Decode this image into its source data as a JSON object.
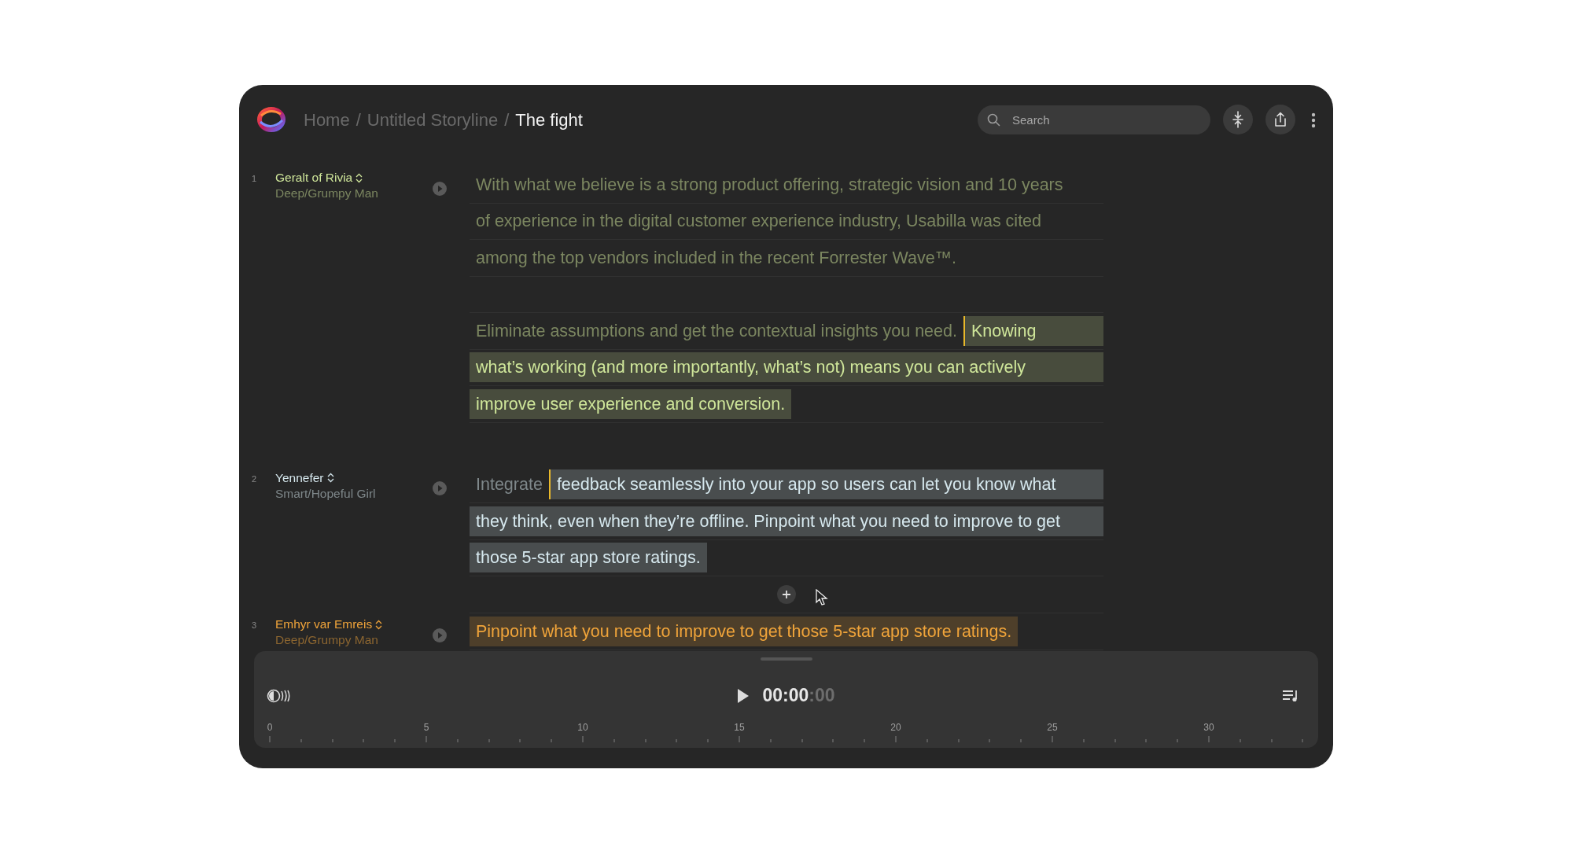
{
  "header": {
    "breadcrumbs": [
      {
        "label": "Home",
        "current": false
      },
      {
        "label": "Untitled Storyline",
        "current": false
      },
      {
        "label": "The fight",
        "current": true
      }
    ],
    "separators": [
      "/",
      "/"
    ],
    "search": {
      "placeholder": "Search"
    }
  },
  "script": [
    {
      "kind": "speaker",
      "number": "1",
      "name": "Geralt of Rivia",
      "voice": "Deep/Grumpy Man",
      "color": "#cfe69a",
      "paragraphs": [
        [
          [
            {
              "text": "With what we believe is a strong product offering, strategic vision and 10 years",
              "highlighted": false,
              "caret": false
            }
          ],
          [
            {
              "text": "of experience in the digital customer experience industry, Usabilla was cited",
              "highlighted": false,
              "caret": false
            }
          ],
          [
            {
              "text": "among the top vendors included in the recent Forrester Wave™.",
              "highlighted": false,
              "caret": false
            }
          ]
        ],
        [
          [
            {
              "text": "Eliminate assumptions and get the contextual insights you need.",
              "highlighted": false,
              "caret": false
            },
            {
              "text": "Knowing",
              "highlighted": true,
              "caret": true
            }
          ],
          [
            {
              "text": "what’s working (and more importantly, what’s not) means you can actively",
              "highlighted": true,
              "caret": false
            }
          ],
          [
            {
              "text": "improve user experience and conversion.",
              "highlighted": true,
              "caret": false
            }
          ]
        ]
      ]
    },
    {
      "kind": "speaker",
      "number": "2",
      "name": "Yennefer",
      "voice": "Smart/Hopeful Girl",
      "color": "#d6e8ee",
      "paragraphs": [
        [
          [
            {
              "text": "Integrate",
              "highlighted": false,
              "caret": false
            },
            {
              "text": "feedback seamlessly into your app so users can let you know what",
              "highlighted": true,
              "caret": true
            }
          ],
          [
            {
              "text": "they think, even when they’re offline. Pinpoint what you need to improve to get",
              "highlighted": true,
              "caret": false
            }
          ],
          [
            {
              "text": "those 5-star app store ratings.",
              "highlighted": true,
              "caret": false
            }
          ]
        ]
      ]
    },
    {
      "kind": "add"
    },
    {
      "kind": "speaker",
      "number": "3",
      "name": "Emhyr var Emreis",
      "voice": "Deep/Grumpy Man",
      "color": "#f0a43a",
      "paragraphs": [
        [
          [
            {
              "text": "Pinpoint what you need to improve to get those 5-star app store ratings.",
              "highlighted": true,
              "caret": false
            }
          ]
        ]
      ]
    }
  ],
  "player": {
    "playing": false,
    "time": "00:00",
    "time_fraction": ":00",
    "ruler_labels": [
      "0",
      "5",
      "10",
      "15",
      "20",
      "25",
      "30"
    ]
  }
}
